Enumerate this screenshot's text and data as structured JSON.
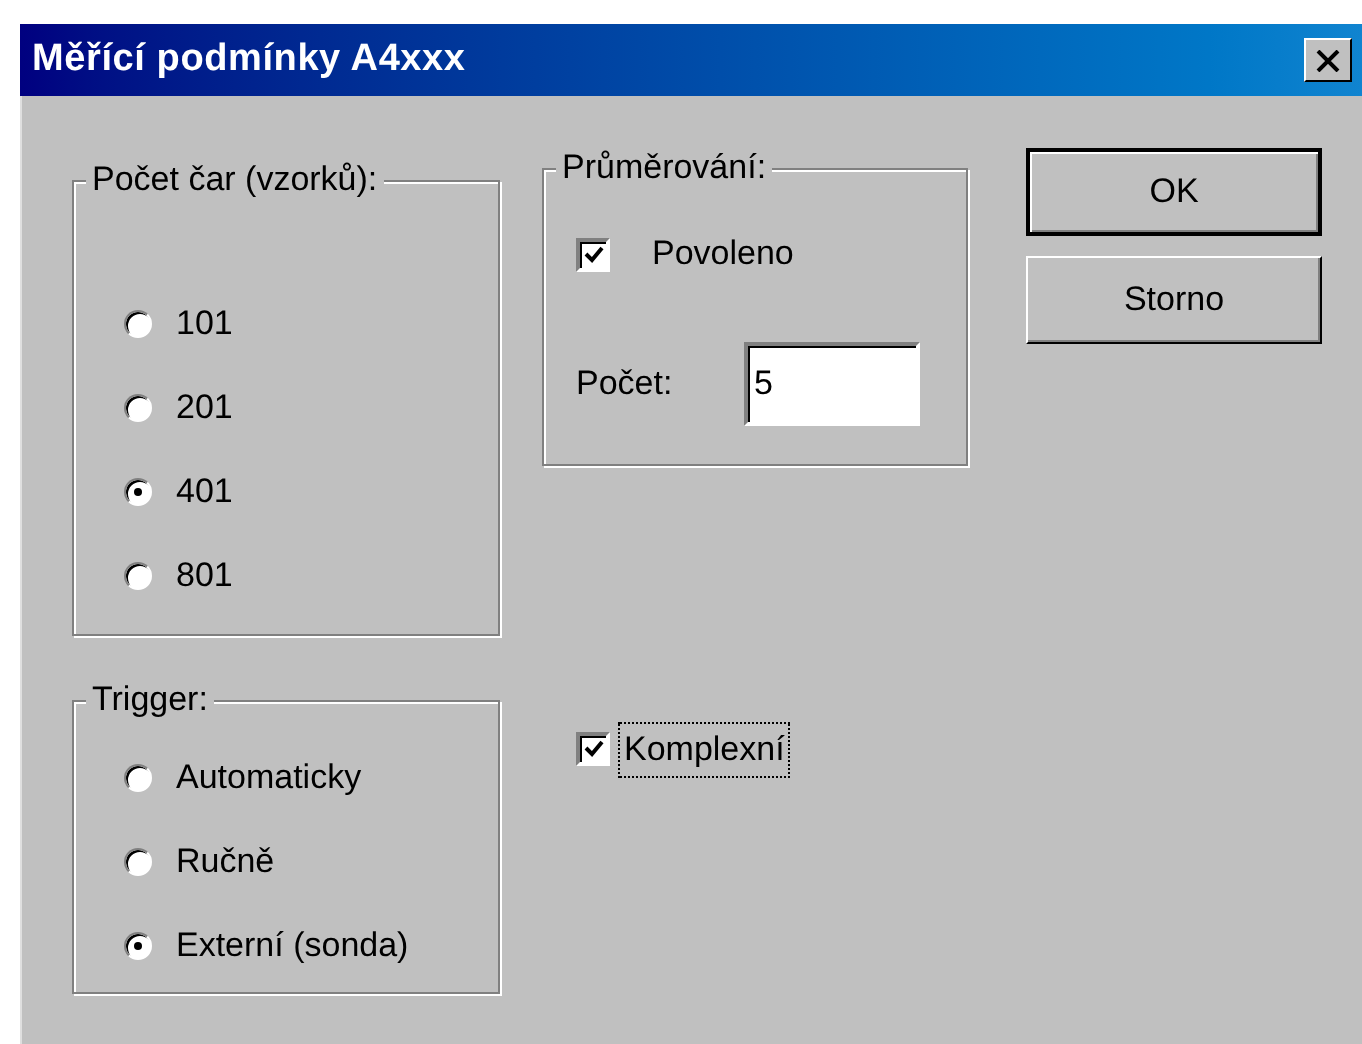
{
  "window": {
    "title": "Měřící podmínky A4xxx"
  },
  "samples_group": {
    "label": "Počet čar (vzorků):",
    "options": [
      {
        "label": "101",
        "selected": false
      },
      {
        "label": "201",
        "selected": false
      },
      {
        "label": "401",
        "selected": true
      },
      {
        "label": "801",
        "selected": false
      }
    ]
  },
  "averaging_group": {
    "label": "Průměrování:",
    "enabled": {
      "label": "Povoleno",
      "checked": true
    },
    "count": {
      "label": "Počet:",
      "value": "5"
    }
  },
  "buttons": [
    {
      "label": "OK",
      "default": true
    },
    {
      "label": "Storno",
      "default": false
    }
  ],
  "trigger_group": {
    "label": "Trigger:",
    "options": [
      {
        "label": "Automaticky",
        "selected": false
      },
      {
        "label": "Ručně",
        "selected": false
      },
      {
        "label": "Externí (sonda)",
        "selected": true
      }
    ]
  },
  "complex": {
    "label": "Komplexní",
    "checked": true,
    "focused": true
  }
}
